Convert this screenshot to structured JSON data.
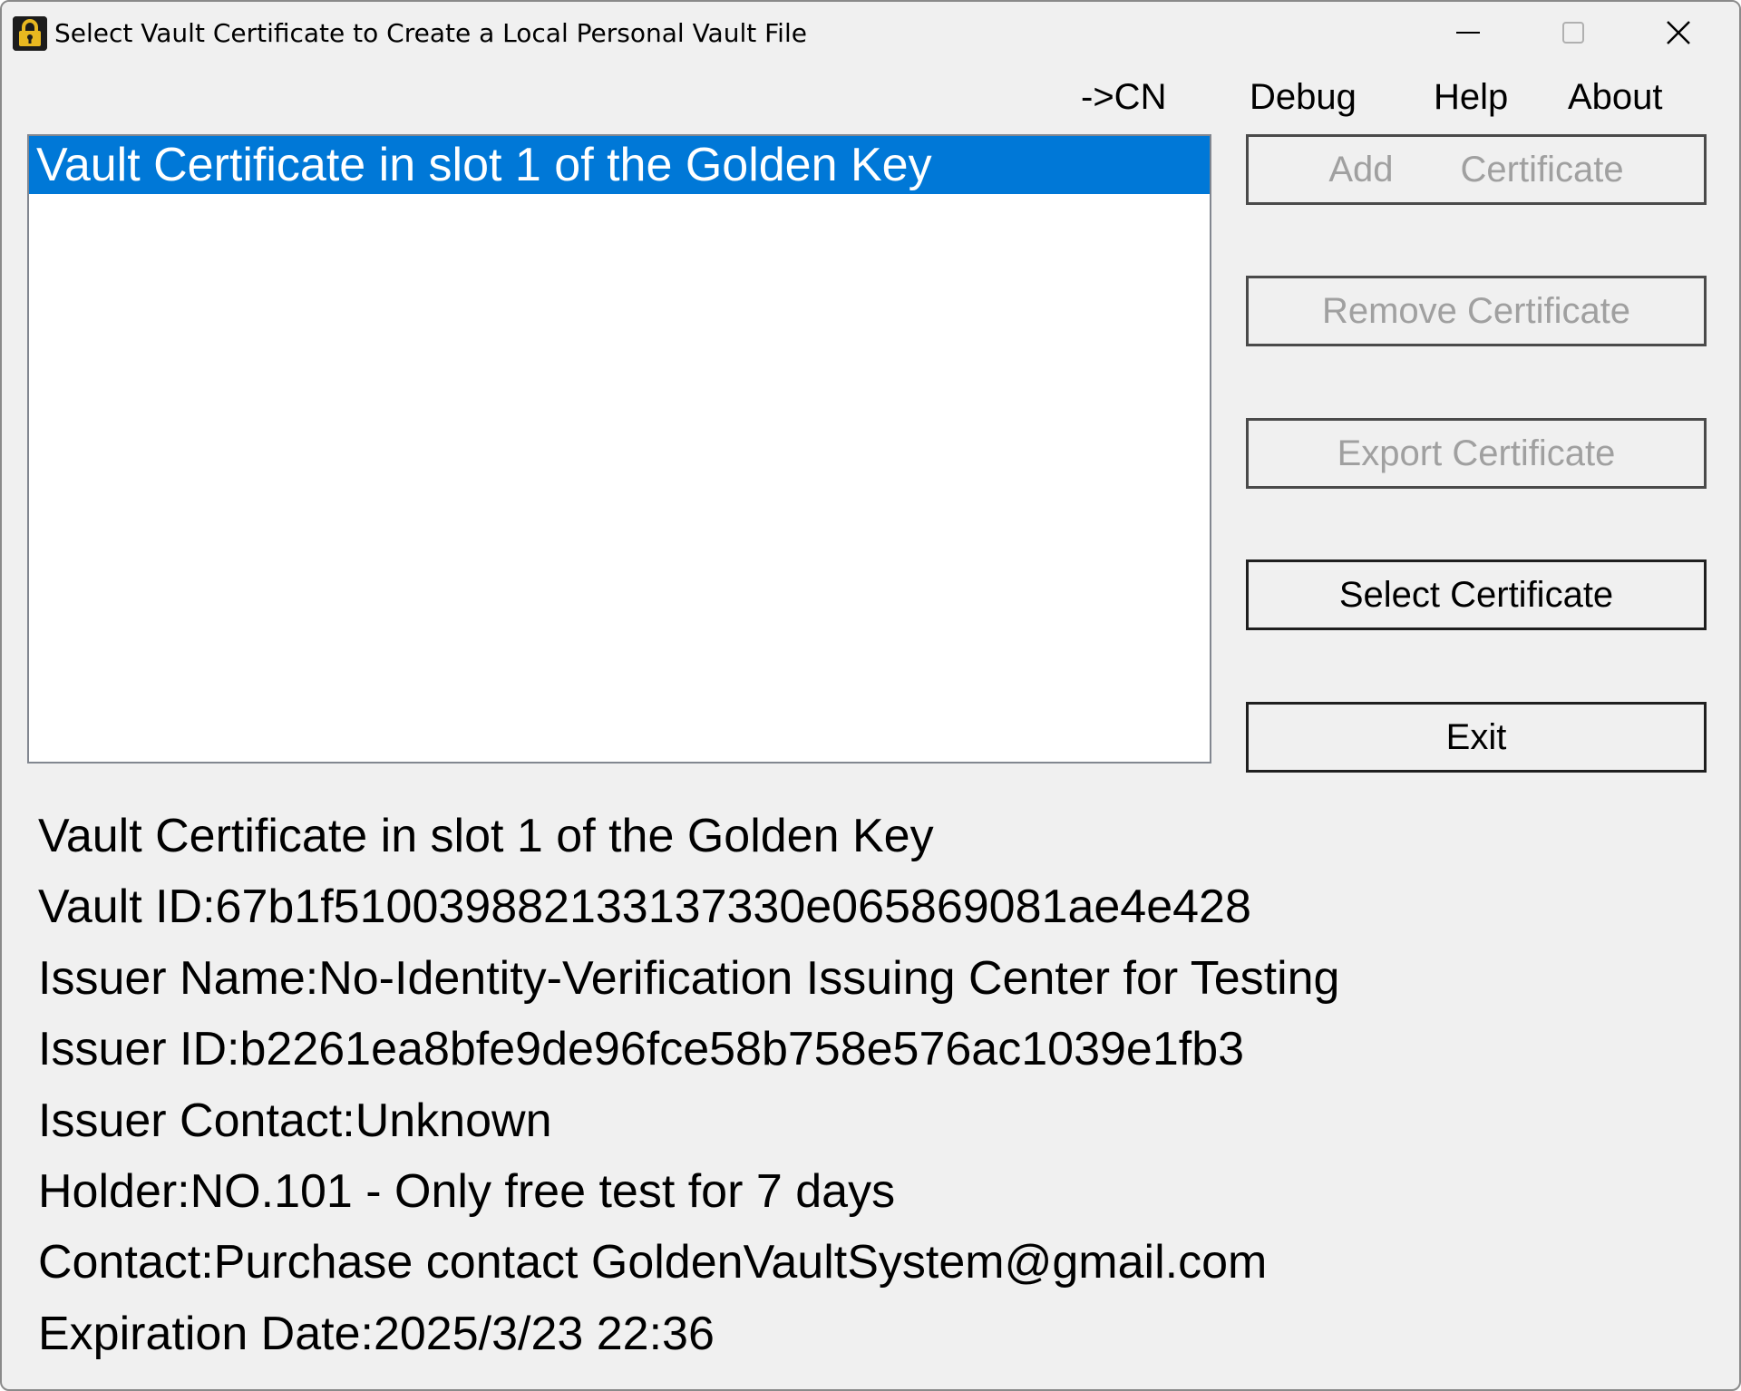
{
  "window": {
    "title": "Select Vault Certificate to Create a Local Personal Vault File",
    "icon": "padlock-icon",
    "controls": [
      "minimize-icon",
      "maximize-icon",
      "close-icon"
    ]
  },
  "menu": {
    "cn": "->CN",
    "debug": "Debug",
    "help": "Help",
    "about": "About"
  },
  "certificate_list": {
    "items": [
      "Vault Certificate in slot 1 of the Golden Key"
    ],
    "selected_index": 0,
    "selection_color": "#0078d7"
  },
  "buttons": {
    "add_word1": "Add",
    "add_word2": "Certificate",
    "remove": "Remove Certificate",
    "export": "Export Certificate",
    "select": "Select Certificate",
    "exit": "Exit"
  },
  "details": {
    "name": "Vault Certificate in slot 1 of the Golden Key",
    "vault_id": "Vault ID:67b1f5100398821331373​30e065869081ae4e428",
    "issuer_name": "Issuer Name:No-Identity-Verification Issuing Center for Testing",
    "issuer_id": "Issuer ID:b2261ea8bfe9de96fce58b758e576ac1039e1fb3",
    "issuer_contact": "Issuer Contact:Unknown",
    "holder": "Holder:NO.101 - Only free test for 7 days",
    "contact": "Contact:Purchase contact GoldenVaultSystem@gmail.com",
    "expiration": "Expiration Date:2025/3/23 22:36"
  }
}
